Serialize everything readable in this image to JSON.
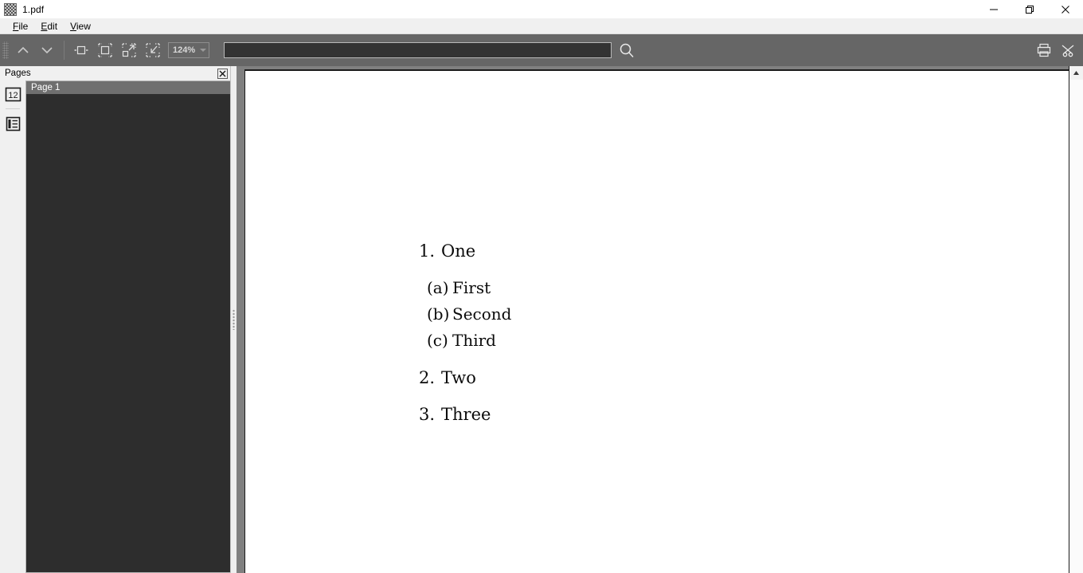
{
  "window": {
    "title": "1.pdf",
    "app_icon": "application-icon",
    "controls": {
      "minimize": "minimize-button",
      "restore": "restore-button",
      "close": "close-button"
    }
  },
  "menubar": {
    "items": [
      {
        "label": "File",
        "mnemonic": "F",
        "rest": "ile"
      },
      {
        "label": "Edit",
        "mnemonic": "E",
        "rest": "dit"
      },
      {
        "label": "View",
        "mnemonic": "V",
        "rest": "iew"
      }
    ]
  },
  "toolbar": {
    "grip": "toolbar-drag-grip",
    "previous_page": "previous-page-icon",
    "next_page": "next-page-icon",
    "fit_width": "fit-width-icon",
    "fit_page": "fit-page-icon",
    "zoom_in": "zoom-in-icon",
    "zoom_out": "zoom-out-icon",
    "zoom_level": "124%",
    "zoom_caret": "chevron-down-icon",
    "search": {
      "value": "",
      "placeholder": "",
      "button_icon": "search-icon"
    },
    "print_icon": "print-icon",
    "snip_icon": "scissors-icon"
  },
  "sidebar": {
    "title": "Pages",
    "close_icon": "close-icon",
    "tabs": [
      {
        "name": "thumbnails-tab",
        "glyph": "12"
      },
      {
        "name": "outline-tab",
        "glyph": "outline-icon"
      }
    ],
    "page_label": "Page 1"
  },
  "document": {
    "list": [
      {
        "marker": "1.",
        "text": "One",
        "sublist": [
          {
            "marker": "(a)",
            "text": "First"
          },
          {
            "marker": "(b)",
            "text": "Second"
          },
          {
            "marker": "(c)",
            "text": "Third"
          }
        ]
      },
      {
        "marker": "2.",
        "text": "Two",
        "sublist": []
      },
      {
        "marker": "3.",
        "text": "Three",
        "sublist": []
      }
    ]
  },
  "scrollbar": {
    "up_arrow": "scroll-up-icon",
    "down_arrow": "scroll-down-icon"
  },
  "colors": {
    "toolbar_bg": "#666666",
    "panel_bg": "#2d2d2d",
    "page_strip": "#6f6f6f",
    "viewer_bg": "#808080",
    "chrome_bg": "#f0f0f0"
  }
}
